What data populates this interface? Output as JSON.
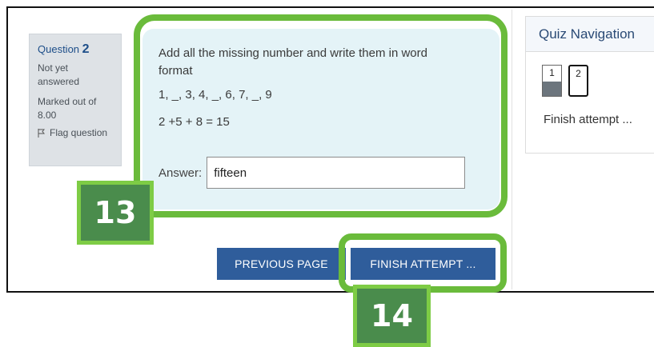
{
  "question_info": {
    "label": "Question",
    "number": "2",
    "state_line1": "Not yet",
    "state_line2": "answered",
    "mark_line1": "Marked out of",
    "mark_line2": "8.00",
    "flag_label": "Flag question"
  },
  "question": {
    "text_line1": "Add all the missing number and write them in word",
    "text_line2": "format",
    "sequence": "1, _, 3, 4, _, 6, 7, _, 9",
    "equation": "2 +5 + 8 = 15",
    "answer_label": "Answer:",
    "answer_value": "fifteen"
  },
  "buttons": {
    "previous": "PREVIOUS PAGE",
    "finish": "FINISH ATTEMPT ..."
  },
  "navigation": {
    "title": "Quiz Navigation",
    "items": [
      {
        "label": "1",
        "answered": true,
        "current": false
      },
      {
        "label": "2",
        "answered": false,
        "current": true
      }
    ],
    "finish_link": "Finish attempt ..."
  },
  "callouts": {
    "badge_13": "13",
    "badge_14": "14"
  },
  "colors": {
    "highlight": "#6abb3b",
    "badge_fill": "#4a8c4c",
    "button": "#2f5d9b",
    "question_bg": "#e4f3f7"
  }
}
